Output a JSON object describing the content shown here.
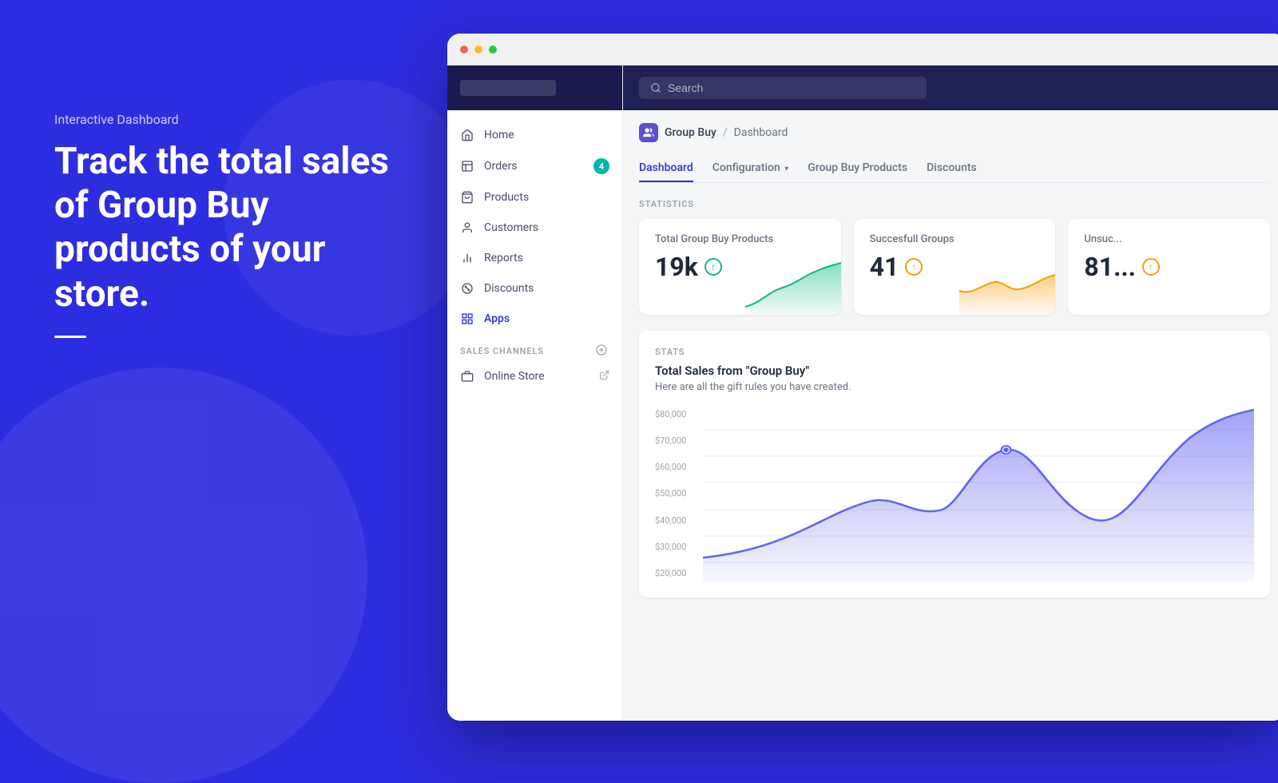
{
  "left": {
    "subtitle": "Interactive Dashboard",
    "headline": "Track the total sales of Group Buy products of your store.",
    "divider": true
  },
  "browser": {
    "dots": [
      "red",
      "yellow",
      "green"
    ]
  },
  "sidebar": {
    "store_placeholder": "",
    "nav_items": [
      {
        "id": "home",
        "label": "Home",
        "icon": "home-icon",
        "badge": null
      },
      {
        "id": "orders",
        "label": "Orders",
        "icon": "orders-icon",
        "badge": "4"
      },
      {
        "id": "products",
        "label": "Products",
        "icon": "products-icon",
        "badge": null
      },
      {
        "id": "customers",
        "label": "Customers",
        "icon": "customers-icon",
        "badge": null
      },
      {
        "id": "reports",
        "label": "Reports",
        "icon": "reports-icon",
        "badge": null
      },
      {
        "id": "discounts",
        "label": "Discounts",
        "icon": "discounts-icon",
        "badge": null
      },
      {
        "id": "apps",
        "label": "Apps",
        "icon": "apps-icon",
        "badge": null
      }
    ],
    "sales_channels_label": "SALES CHANNELS",
    "sales_channels": [
      {
        "id": "online-store",
        "label": "Online Store",
        "icon": "store-icon",
        "external": true
      }
    ]
  },
  "topbar": {
    "search_placeholder": "Search"
  },
  "breadcrumb": {
    "app_name": "Group Buy",
    "separator": "/",
    "current": "Dashboard"
  },
  "tabs": [
    {
      "id": "dashboard",
      "label": "Dashboard",
      "active": true
    },
    {
      "id": "configuration",
      "label": "Configuration",
      "active": false,
      "caret": true
    },
    {
      "id": "group-buy-products",
      "label": "Group Buy Products",
      "active": false
    },
    {
      "id": "discounts",
      "label": "Discounts",
      "active": false
    }
  ],
  "statistics": {
    "section_label": "STATISTICS",
    "cards": [
      {
        "id": "total-group-buy",
        "title": "Total Group Buy Products",
        "value": "19k",
        "icon_type": "green",
        "icon_symbol": "↑"
      },
      {
        "id": "successful-groups",
        "title": "Succesfull Groups",
        "value": "41",
        "icon_type": "yellow",
        "icon_symbol": "↑"
      },
      {
        "id": "unsuccessful",
        "title": "Unsuc...",
        "value": "81...",
        "icon_type": "yellow",
        "icon_symbol": "↑"
      }
    ]
  },
  "stats_chart": {
    "section_label": "STATS",
    "title": "Total Sales from \"Group Buy\"",
    "subtitle": "Here are all the gift rules you have created.",
    "y_labels": [
      "$80,000",
      "$70,000",
      "$60,000",
      "$50,000",
      "$40,000",
      "$30,000",
      "$20,000"
    ]
  },
  "colors": {
    "brand_blue": "#2d2de0",
    "sidebar_dark": "#1a1a4e",
    "topbar_dark": "#1e2154",
    "green": "#10b981",
    "yellow": "#f59e0b",
    "purple_chart": "#6366f1",
    "green_chart": "#10b981"
  }
}
